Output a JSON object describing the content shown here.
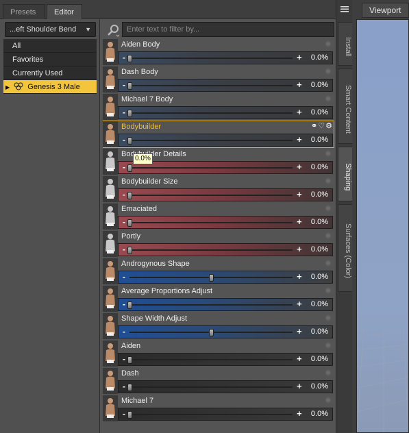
{
  "tabs": [
    "Presets",
    "Editor"
  ],
  "left": {
    "dropdown": "...eft Shoulder Bend",
    "categories": [
      "All",
      "Favorites",
      "Currently Used"
    ],
    "selected": "Genesis 3 Male"
  },
  "filter": {
    "placeholder": "Enter text to filter by..."
  },
  "rows": [
    {
      "label": "Aiden Body",
      "value": "0.0%",
      "color": "gray",
      "level": 0
    },
    {
      "label": "Dash Body",
      "value": "0.0%",
      "color": "gray",
      "level": 0
    },
    {
      "label": "Michael 7 Body",
      "value": "0.0%",
      "color": "gray",
      "level": 0
    },
    {
      "label": "Bodybuilder",
      "value": "0.0%",
      "color": "gray",
      "level": 0,
      "selected": true
    },
    {
      "label": "Bodybuilder Details",
      "value": "0.0%",
      "color": "red",
      "level": 0
    },
    {
      "label": "Bodybuilder Size",
      "value": "0.0%",
      "color": "red",
      "level": 0
    },
    {
      "label": "Emaciated",
      "value": "0.0%",
      "color": "red",
      "level": 0
    },
    {
      "label": "Portly",
      "value": "0.0%",
      "color": "red",
      "level": 0
    },
    {
      "label": "Androgynous Shape",
      "value": "0.0%",
      "color": "blue",
      "level": 0.5
    },
    {
      "label": "Average Proportions Adjust",
      "value": "0.0%",
      "color": "blue",
      "level": 0
    },
    {
      "label": "Shape Width Adjust",
      "value": "0.0%",
      "color": "blue",
      "level": 0.5
    },
    {
      "label": "Aiden",
      "value": "0.0%",
      "color": "plain",
      "level": 0
    },
    {
      "label": "Dash",
      "value": "0.0%",
      "color": "plain",
      "level": 0
    },
    {
      "label": "Michael 7",
      "value": "0.0%",
      "color": "plain",
      "level": 0
    }
  ],
  "tooltip": "0.0%",
  "side_tabs": [
    "Install",
    "Smart Content",
    "Shaping",
    "Surfaces (Color)"
  ],
  "viewport_tab": "Viewport",
  "accent": "#f2c53d"
}
